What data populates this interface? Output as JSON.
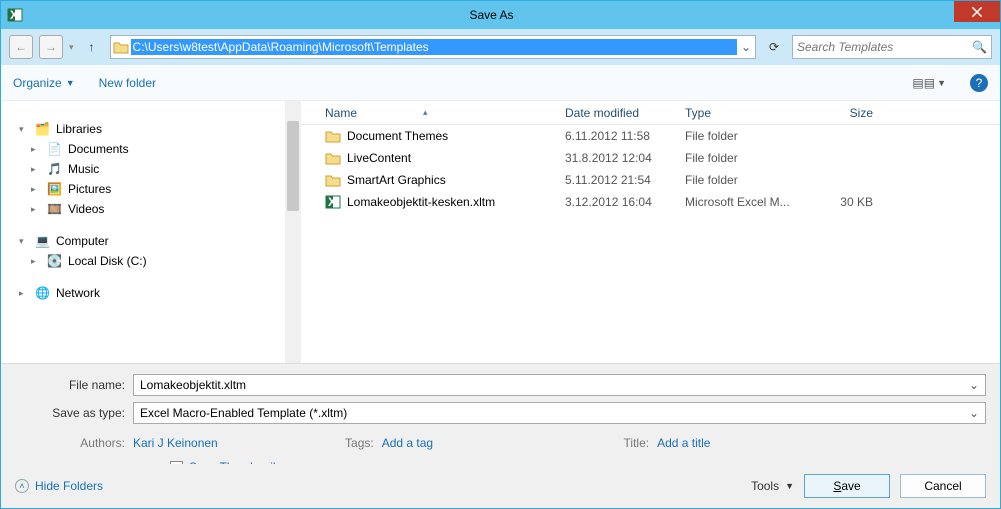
{
  "window": {
    "title": "Save As"
  },
  "nav": {
    "path": "C:\\Users\\w8test\\AppData\\Roaming\\Microsoft\\Templates",
    "search_placeholder": "Search Templates"
  },
  "toolbar": {
    "organize": "Organize",
    "newfolder": "New folder"
  },
  "sidebar": {
    "libraries": "Libraries",
    "documents": "Documents",
    "music": "Music",
    "pictures": "Pictures",
    "videos": "Videos",
    "computer": "Computer",
    "localdisk": "Local Disk (C:)",
    "network": "Network"
  },
  "columns": {
    "name": "Name",
    "date": "Date modified",
    "type": "Type",
    "size": "Size"
  },
  "rows": [
    {
      "name": "Document Themes",
      "date": "6.11.2012 11:58",
      "type": "File folder",
      "size": "",
      "icon": "folder"
    },
    {
      "name": "LiveContent",
      "date": "31.8.2012 12:04",
      "type": "File folder",
      "size": "",
      "icon": "folder"
    },
    {
      "name": "SmartArt Graphics",
      "date": "5.11.2012 21:54",
      "type": "File folder",
      "size": "",
      "icon": "folder"
    },
    {
      "name": "Lomakeobjektit-kesken.xltm",
      "date": "3.12.2012 16:04",
      "type": "Microsoft Excel M...",
      "size": "30 KB",
      "icon": "excel"
    }
  ],
  "form": {
    "filename_label": "File name:",
    "filename_value": "Lomakeobjektit.xltm",
    "saveas_label": "Save as type:",
    "saveas_value": "Excel Macro-Enabled Template (*.xltm)"
  },
  "meta": {
    "authors_label": "Authors:",
    "authors_value": "Kari J Keinonen",
    "tags_label": "Tags:",
    "tags_value": "Add a tag",
    "title_label": "Title:",
    "title_value": "Add a title",
    "thumb_label": "Save Thumbnail"
  },
  "footer": {
    "hide": "Hide Folders",
    "tools": "Tools",
    "save": "Save",
    "cancel": "Cancel"
  }
}
